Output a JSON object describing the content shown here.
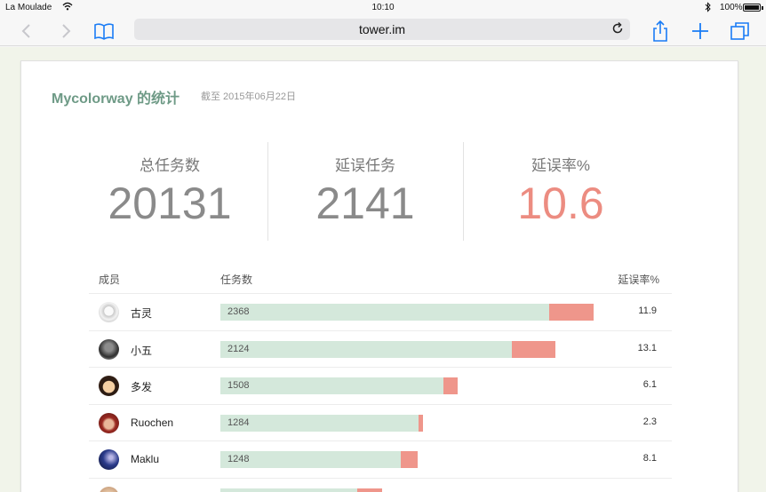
{
  "status_bar": {
    "carrier": "La Moulade",
    "time": "10:10",
    "battery": "100%"
  },
  "browser": {
    "url": "tower.im",
    "icons": [
      "back-icon",
      "forward-icon",
      "bookmarks-icon",
      "reload-icon",
      "share-icon",
      "new-tab-icon",
      "tabs-icon"
    ]
  },
  "report": {
    "title": "Mycolorway 的统计",
    "subtitle": "截至 2015年06月22日",
    "stats": [
      {
        "label": "总任务数",
        "value": "20131"
      },
      {
        "label": "延误任务",
        "value": "2141"
      },
      {
        "label": "延误率%",
        "value": "10.6"
      }
    ],
    "accent_color": "#6e9a86",
    "delay_color": "#ef968b",
    "ontime_color": "#d4e8db"
  },
  "table": {
    "headers": {
      "member": "成员",
      "tasks": "任务数",
      "rate": "延误率%"
    },
    "rows": [
      {
        "name": "古灵",
        "tasks": "2368",
        "rate": "11.9"
      },
      {
        "name": "小五",
        "tasks": "2124",
        "rate": "13.1"
      },
      {
        "name": "多发",
        "tasks": "1508",
        "rate": "6.1"
      },
      {
        "name": "Ruochen",
        "tasks": "1284",
        "rate": "2.3"
      },
      {
        "name": "Maklu",
        "tasks": "1248",
        "rate": "8.1"
      },
      {
        "name": "",
        "tasks": "",
        "rate": ""
      }
    ]
  }
}
